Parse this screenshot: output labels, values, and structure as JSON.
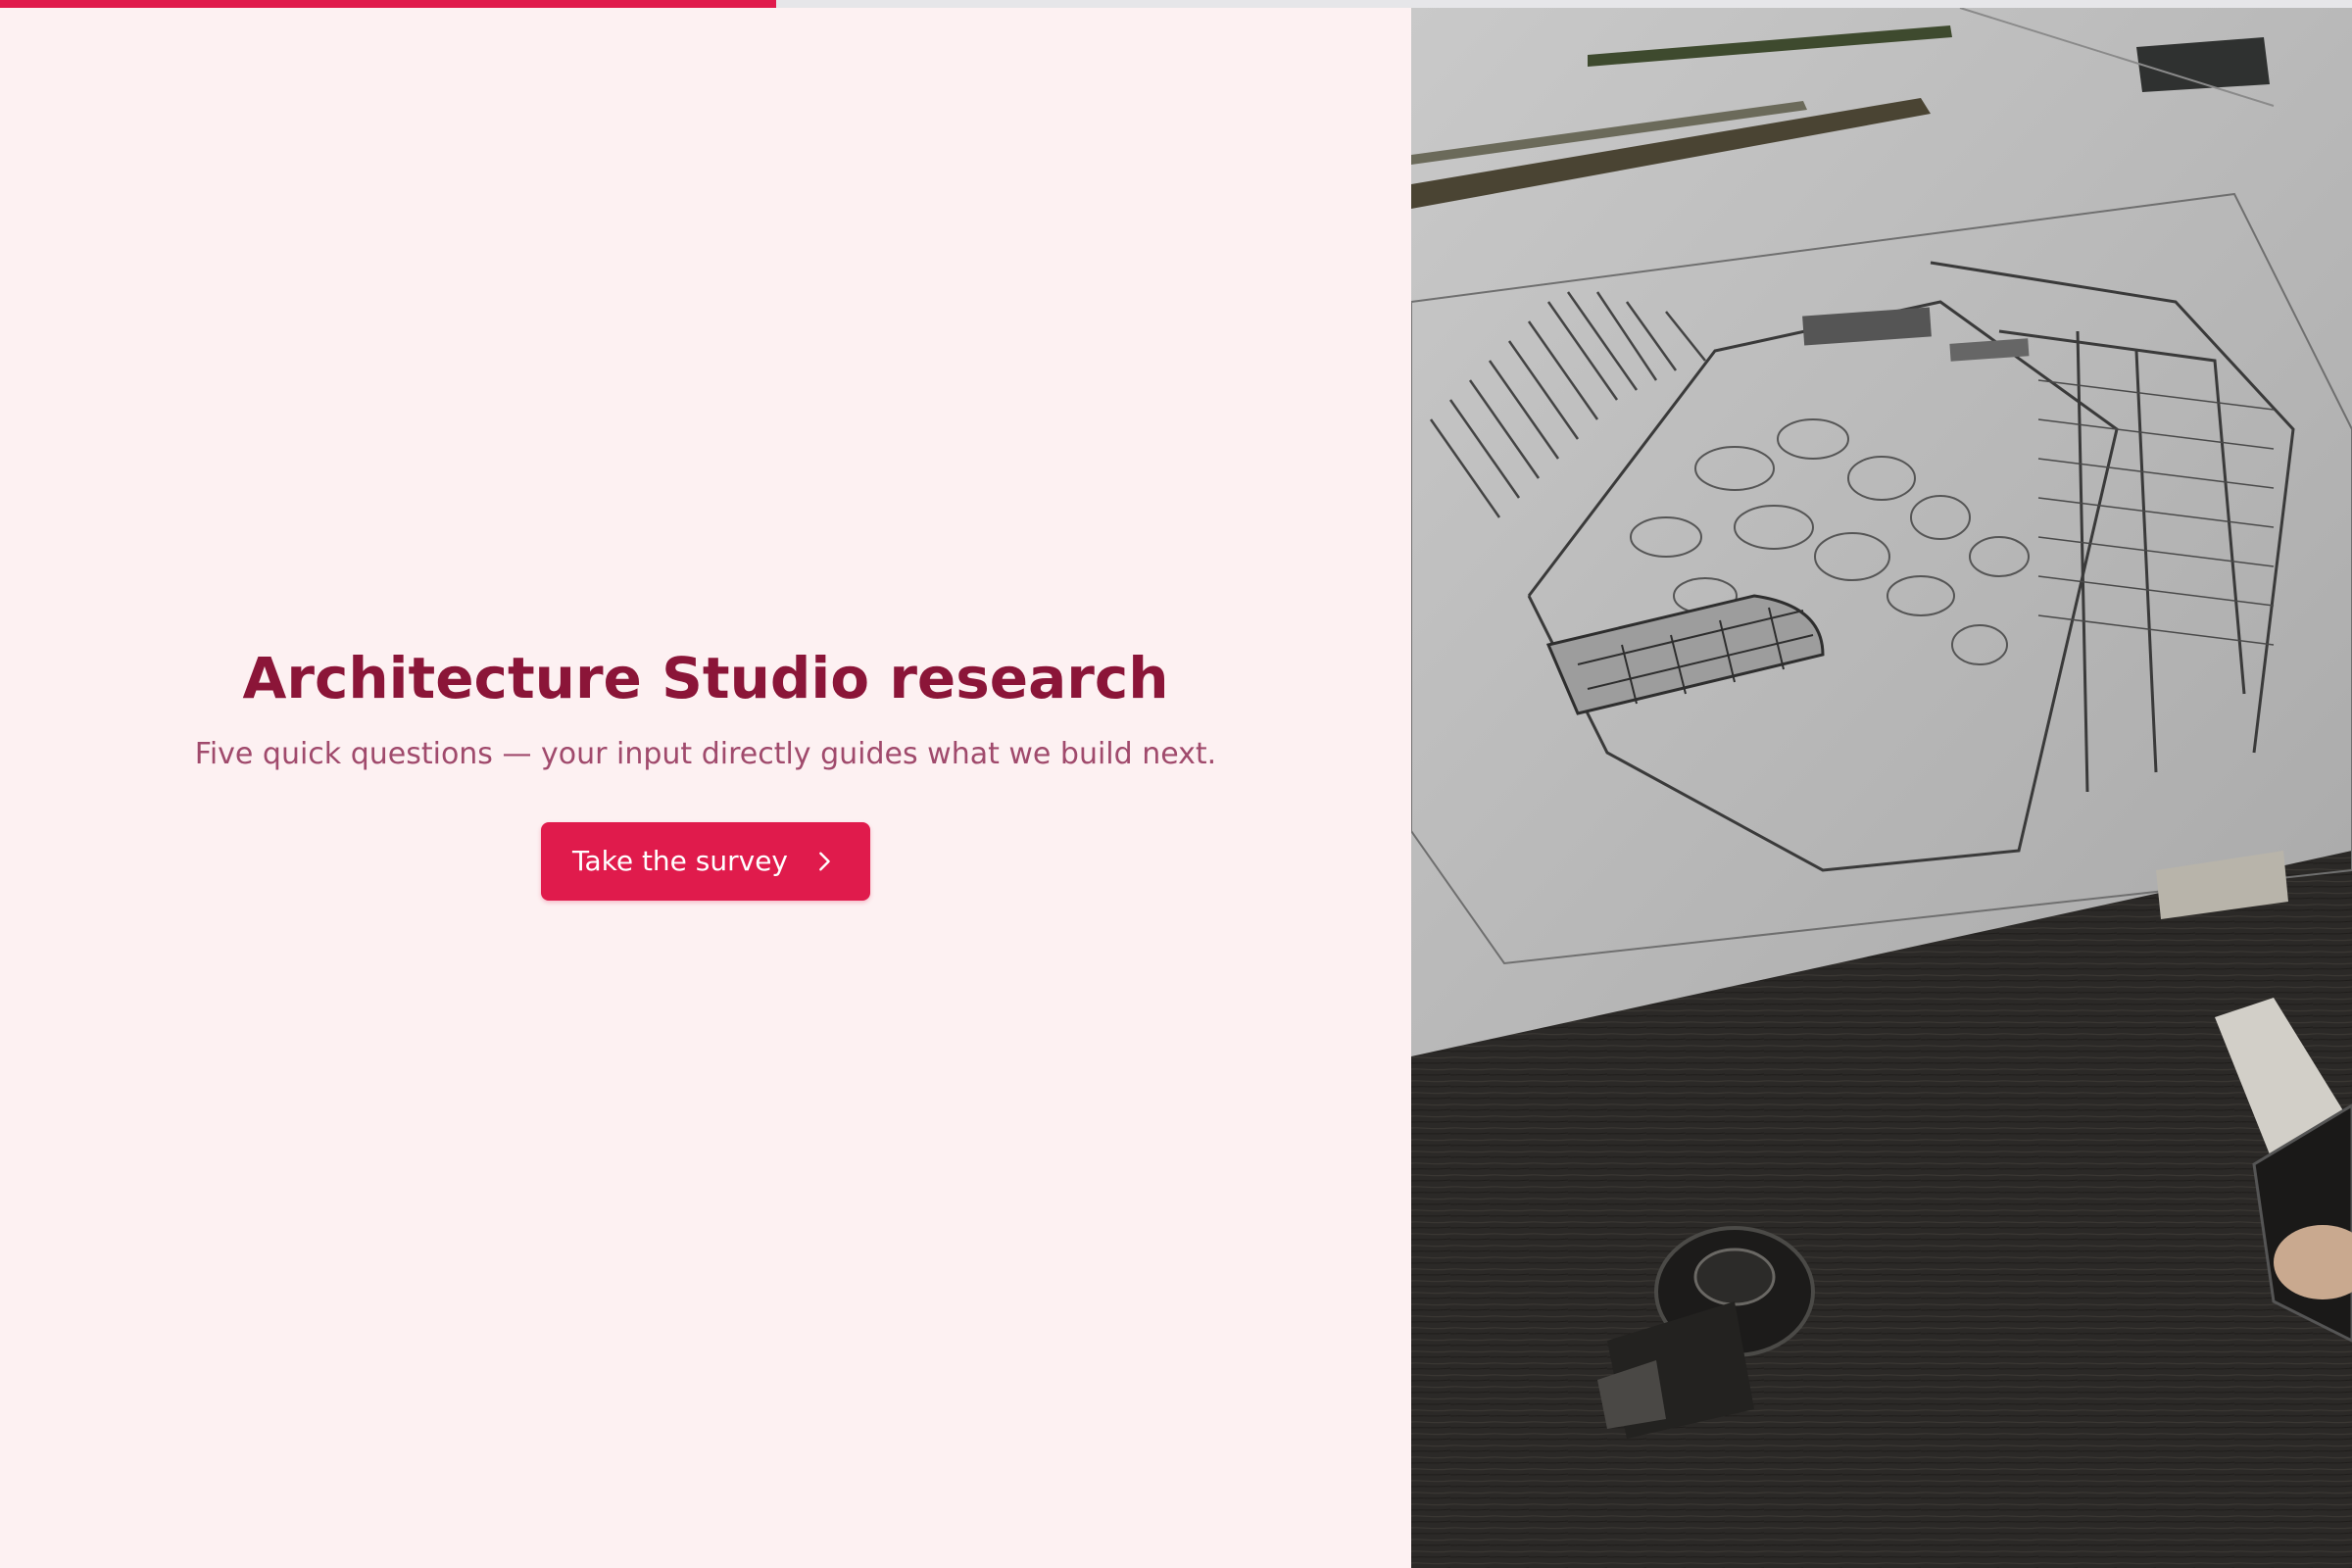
{
  "progress": {
    "value": 0.33,
    "color": "#e01b4c",
    "track_color": "#e6e6e9"
  },
  "hero": {
    "title": "Architecture Studio research",
    "subtitle": "Five quick questions — your input directly guides what we build next.",
    "cta_label": "Take the survey",
    "cta_icon": "chevron-right-icon"
  },
  "colors": {
    "background": "#fdf1f2",
    "title": "#8b1538",
    "subtitle": "#a04a6c",
    "accent": "#e01b4c"
  },
  "cover_image": {
    "subject": "pencil-architecture-sketch-photo"
  }
}
